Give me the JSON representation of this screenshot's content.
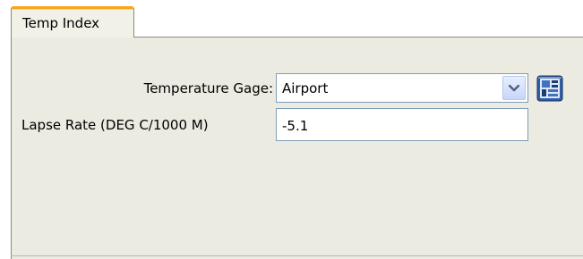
{
  "tabs": [
    {
      "label": "Temp Index",
      "selected": true
    }
  ],
  "form": {
    "temperature_gage": {
      "label": "Temperature Gage:",
      "value": "Airport"
    },
    "lapse_rate": {
      "label": "Lapse Rate (DEG C/1000 M)",
      "value": "-5.1"
    }
  },
  "icons": {
    "dropdown": "chevron-down-icon",
    "side_button": "data-editor-icon"
  },
  "colors": {
    "tab_accent": "#f7a51a",
    "panel_background": "#ecebe2",
    "field_border": "#7f9db9"
  }
}
